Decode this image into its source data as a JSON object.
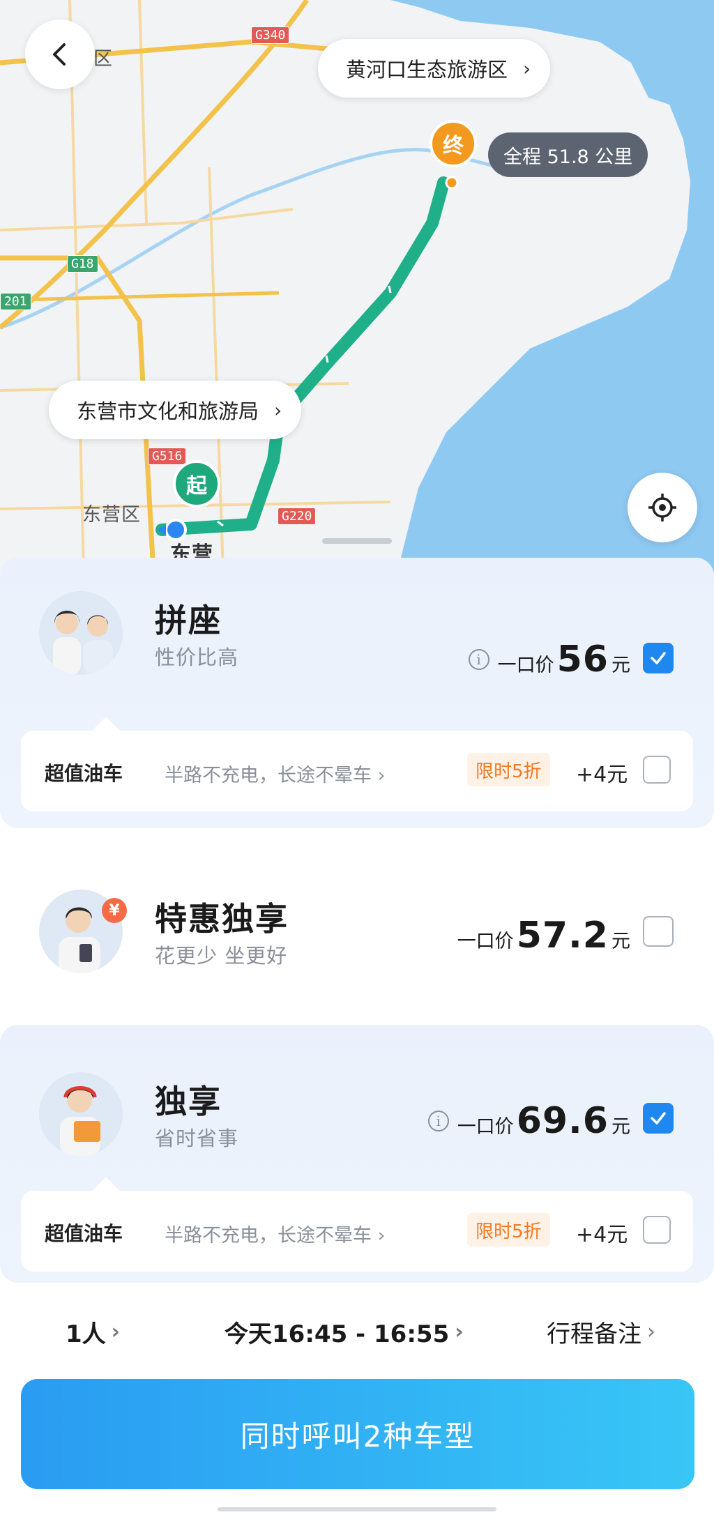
{
  "map": {
    "district_label": "东营区",
    "city_label": "东营",
    "corner_label": "区",
    "roads": [
      "G340",
      "G18",
      "G516",
      "G220",
      "201"
    ],
    "destination_poi": "黄河口生态旅游区",
    "origin_poi": "东营市文化和旅游局",
    "distance": "全程 51.8 公里",
    "start_marker": "起",
    "end_marker": "终",
    "icons": {
      "back": "back-chevron-icon",
      "locate": "locate-target-icon"
    },
    "colors": {
      "route": "#1fb08a",
      "sea": "#8ec9f2",
      "start": "#1ea87c",
      "end": "#f39a1e"
    }
  },
  "rides": [
    {
      "title": "拼座",
      "subtitle": "性价比高",
      "price_prefix": "一口价",
      "price": "56",
      "unit": "元",
      "checked": true,
      "addon": {
        "title": "超值油车",
        "desc": "半路不充电，长途不晕车 ›",
        "tag": "限时5折",
        "extra": "+4元"
      }
    },
    {
      "title": "特惠独享",
      "subtitle": "花更少 坐更好",
      "badge": "¥",
      "price_prefix": "一口价",
      "price": "57.2",
      "unit": "元",
      "checked": false
    },
    {
      "title": "独享",
      "subtitle": "省时省事",
      "price_prefix": "一口价",
      "price": "69.6",
      "unit": "元",
      "checked": true,
      "addon": {
        "title": "超值油车",
        "desc": "半路不充电，长途不晕车 ›",
        "tag": "限时5折",
        "extra": "+4元"
      }
    }
  ],
  "options": {
    "passengers": "1人",
    "time": "今天16:45 - 16:55",
    "note": "行程备注"
  },
  "call_button": "同时呼叫2种车型",
  "accent_color": "#1f87f0"
}
